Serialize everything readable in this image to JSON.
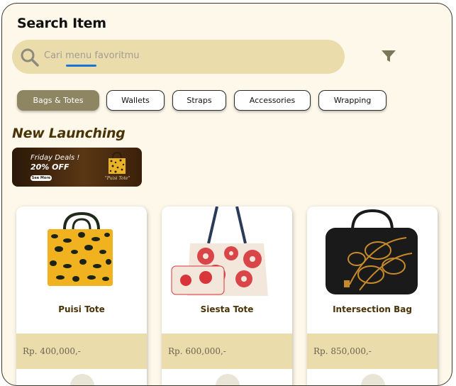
{
  "header": {
    "title": "Search Item"
  },
  "search": {
    "placeholder": "Cari menu favoritmu",
    "icon": "search-icon",
    "filter_icon": "filter-icon"
  },
  "categories": [
    {
      "label": "Bags & Totes",
      "active": true
    },
    {
      "label": "Wallets",
      "active": false
    },
    {
      "label": "Straps",
      "active": false
    },
    {
      "label": "Accessories",
      "active": false
    },
    {
      "label": "Wrapping",
      "active": false
    }
  ],
  "section": {
    "title": "New Launching"
  },
  "banner": {
    "line1": "Friday Deals !",
    "line2": "20% OFF",
    "button": "See More",
    "caption": "\"Puisi Tote\""
  },
  "products": [
    {
      "name": "Puisi Tote",
      "price": "Rp.  400,000,-"
    },
    {
      "name": "Siesta Tote",
      "price": "Rp.  600,000,-"
    },
    {
      "name": "Intersection Bag",
      "price": "Rp.  850,000,-"
    }
  ],
  "colors": {
    "background": "#fdf8e9",
    "search_bg": "#ebdcab",
    "chip_active": "#8e8563",
    "accent_text": "#4a3306",
    "price_band": "#ebdcab"
  }
}
